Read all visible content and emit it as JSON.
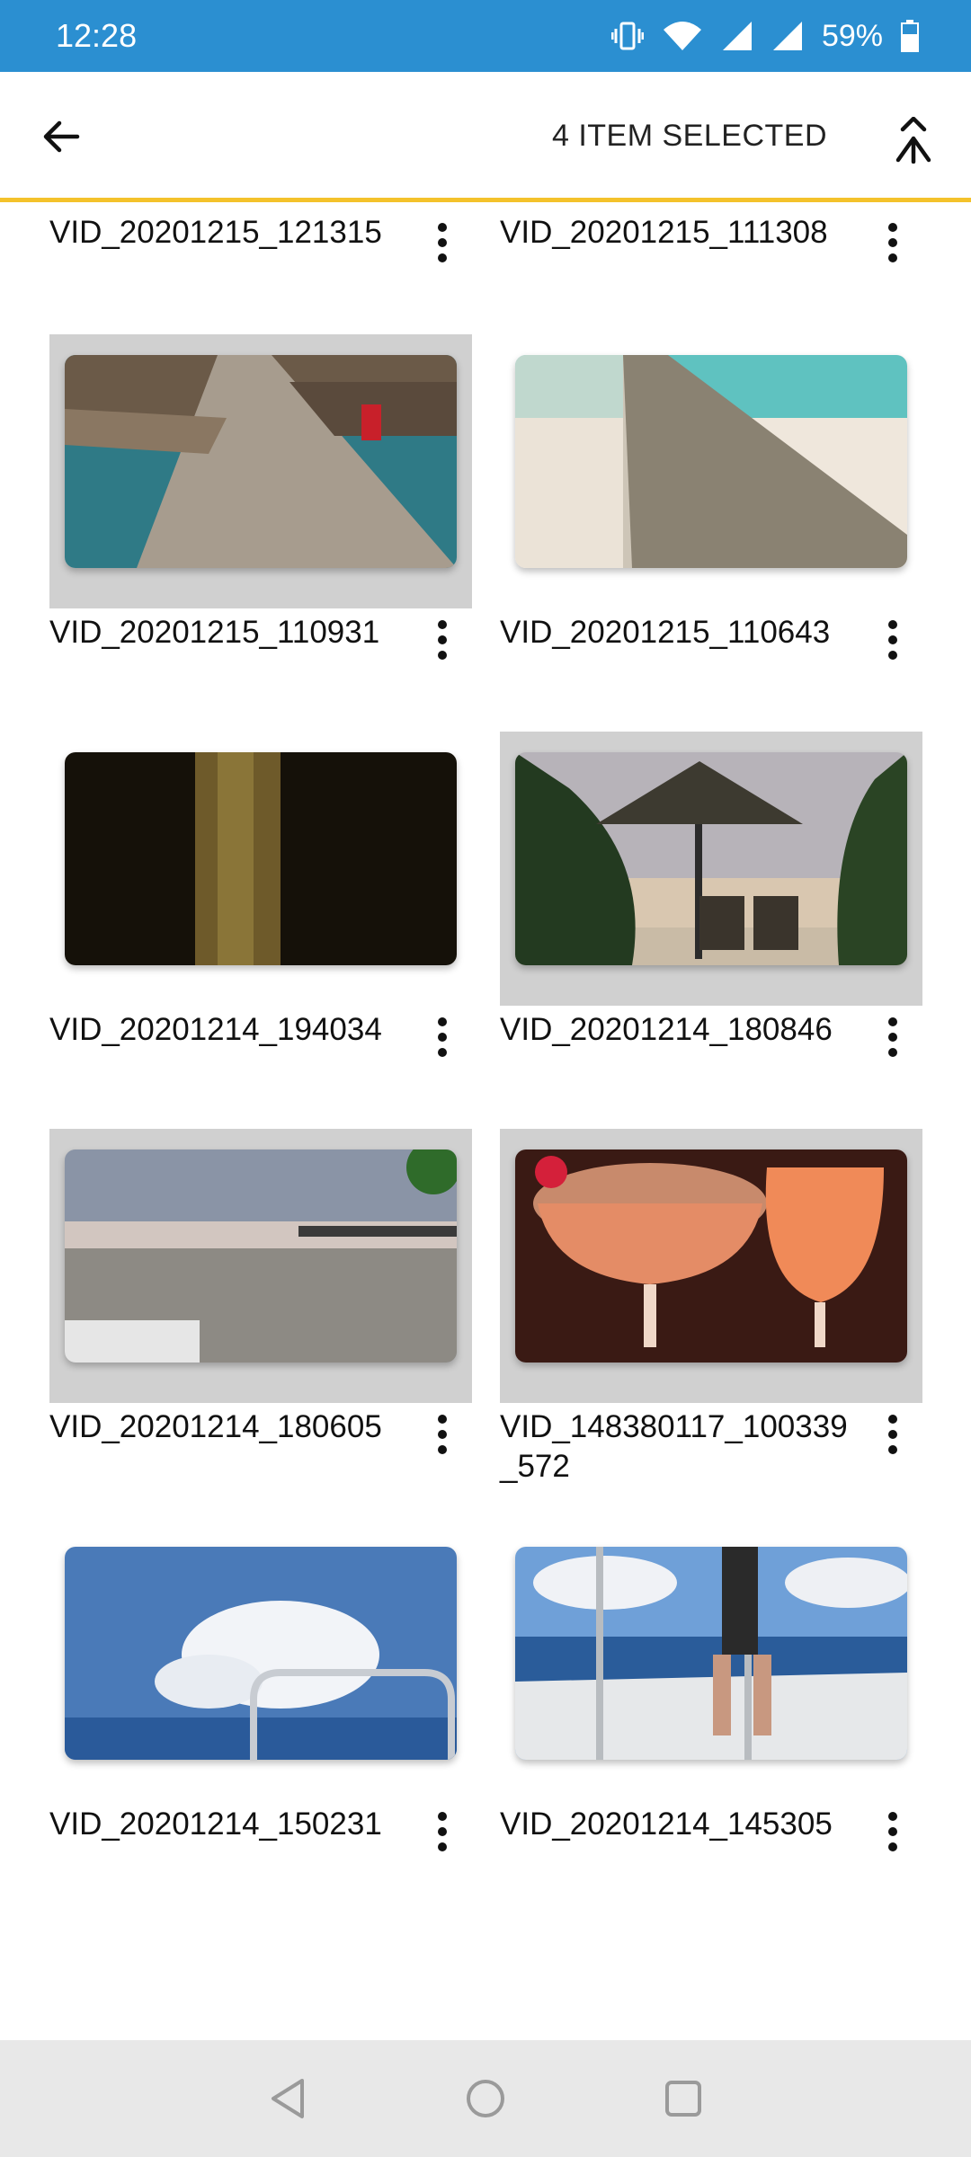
{
  "status_bar": {
    "time": "12:28",
    "battery_pct": "59%",
    "icons": [
      "vibrate-icon",
      "wifi-icon",
      "signal-icon",
      "signal-icon-2",
      "battery-icon"
    ]
  },
  "app_bar": {
    "selection_title": "4 ITEM SELECTED",
    "back_icon": "arrow-left-icon",
    "merge_icon": "merge-icon",
    "accent_color": "#f4c22b"
  },
  "videos": [
    {
      "name": "VID_20201215_121315",
      "selected": false
    },
    {
      "name": "VID_20201215_111308",
      "selected": false
    },
    {
      "name": "VID_20201215_110931",
      "selected": true
    },
    {
      "name": "VID_20201215_110643",
      "selected": false
    },
    {
      "name": "VID_20201214_194034",
      "selected": false
    },
    {
      "name": "VID_20201214_180846",
      "selected": true
    },
    {
      "name": "VID_20201214_180605",
      "selected": true
    },
    {
      "name": "VID_148380117_100339_572",
      "selected": true
    },
    {
      "name": "VID_20201214_150231",
      "selected": false
    },
    {
      "name": "VID_20201214_145305",
      "selected": false
    }
  ],
  "nav_bar": {
    "icons": [
      "back-triangle-icon",
      "home-circle-icon",
      "recents-square-icon"
    ]
  }
}
